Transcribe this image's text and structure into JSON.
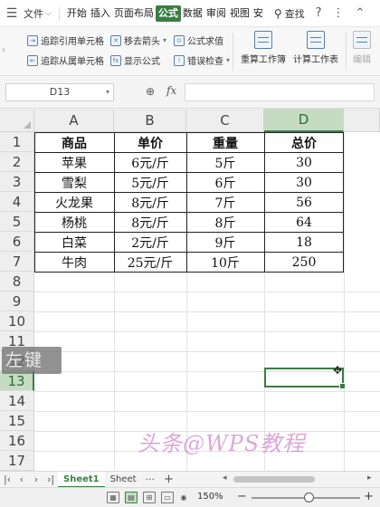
{
  "menubar": {
    "file_label": "文件",
    "tabs": [
      "开始",
      "插入",
      "页面布局",
      "公式",
      "数据",
      "审阅",
      "视图",
      "安"
    ],
    "active_tab": "公式",
    "search_label": "查找"
  },
  "ribbon": {
    "row1": [
      "追踪引用单元格",
      "移去箭头",
      "公式求值"
    ],
    "row2": [
      "追踪从属单元格",
      "显示公式",
      "错误检查"
    ],
    "big": [
      "重算工作簿",
      "计算工作表",
      "编辑"
    ]
  },
  "formula_bar": {
    "cell_ref": "D13",
    "formula_value": ""
  },
  "grid": {
    "columns": [
      "A",
      "B",
      "C",
      "D"
    ],
    "selected_column": "D",
    "rows": [
      "1",
      "2",
      "3",
      "4",
      "5",
      "6",
      "7",
      "8",
      "9",
      "10",
      "11",
      "12",
      "13",
      "14",
      "15",
      "16",
      "17"
    ],
    "selected_row": "13",
    "table": {
      "headers": [
        "商品",
        "单价",
        "重量",
        "总价"
      ],
      "rows": [
        [
          "苹果",
          "6元/斤",
          "5斤",
          "30"
        ],
        [
          "雪梨",
          "5元/斤",
          "6斤",
          "30"
        ],
        [
          "火龙果",
          "8元/斤",
          "7斤",
          "56"
        ],
        [
          "杨桃",
          "8元/斤",
          "8斤",
          "64"
        ],
        [
          "白菜",
          "2元/斤",
          "9斤",
          "18"
        ],
        [
          "牛肉",
          "25元/斤",
          "10斤",
          "250"
        ]
      ]
    },
    "key_overlay": "左键",
    "watermark": "头条@WPS教程"
  },
  "sheets": {
    "tabs": [
      "Sheet1",
      "Sheet"
    ],
    "active": "Sheet1"
  },
  "statusbar": {
    "zoom": "150%",
    "zoom_level": 0.55
  }
}
